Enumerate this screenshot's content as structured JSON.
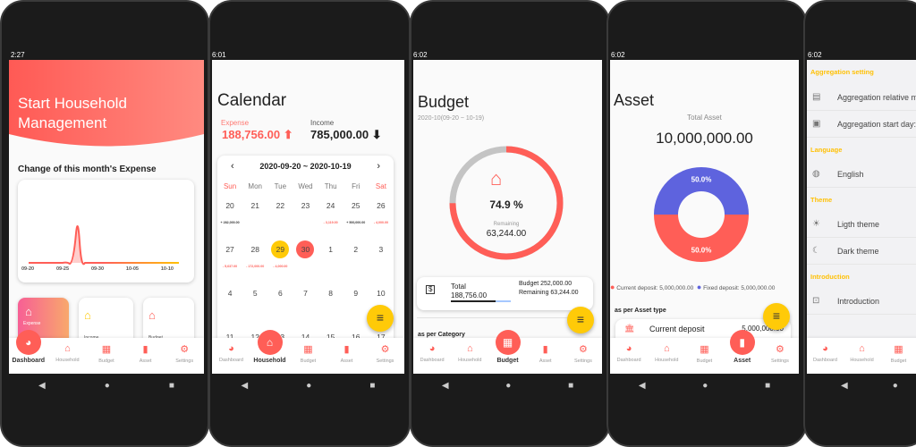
{
  "colors": {
    "accent": "#ff5e57",
    "fab": "#ffca08",
    "fixed": "#5e63de",
    "settings_header": "#ffc107"
  },
  "bottom_nav": [
    "Dashboard",
    "Household",
    "Budget",
    "Asset",
    "Settings"
  ],
  "phones": {
    "dashboard": {
      "time": "2:27",
      "title_line1": "Start Household",
      "title_line2": "Management",
      "chart_title": "Change of this month's Expense",
      "chart_data": {
        "type": "area",
        "x_ticks": [
          "09-20",
          "09-25",
          "09-30",
          "10-05",
          "10-10"
        ],
        "description_values": [
          0,
          0,
          0.01,
          0,
          0.02,
          1,
          0,
          0,
          0,
          0,
          0,
          0,
          0,
          0,
          0,
          0,
          0,
          0,
          0,
          0,
          0,
          0,
          0,
          0,
          0
        ]
      },
      "cards": [
        "Expense",
        "Income",
        "Budget"
      ]
    },
    "calendar": {
      "time": "6:01",
      "title": "Calendar",
      "expense_label": "Expense",
      "expense": "188,756.00",
      "income_label": "Income",
      "income": "785,000.00",
      "range": "2020-09-20 ~ 2020-10-19",
      "weekdays": [
        "Sun",
        "Mon",
        "Tue",
        "Wed",
        "Thu",
        "Fri",
        "Sat"
      ],
      "weeks": [
        {
          "days": [
            "20",
            "21",
            "22",
            "23",
            "24",
            "25",
            "26"
          ],
          "amounts": [
            "+ 282,000.00",
            "",
            "",
            "",
            "- 3,119.00",
            "+ 500,000.00",
            "- 4,000.00"
          ]
        },
        {
          "days": [
            "27",
            "28",
            "29",
            "30",
            "1",
            "2",
            "3"
          ],
          "amounts": [
            "- 5,637.00",
            "- 172,000.00",
            "- 4,000.00",
            "",
            "",
            "",
            ""
          ]
        },
        {
          "days": [
            "4",
            "5",
            "6",
            "7",
            "8",
            "9",
            "10"
          ],
          "amounts": [
            "",
            "",
            "",
            "",
            "",
            "",
            ""
          ]
        },
        {
          "days": [
            "11",
            "12",
            "13",
            "14",
            "15",
            "16",
            "17"
          ],
          "amounts": [
            "",
            "",
            "",
            "",
            "",
            "",
            ""
          ]
        }
      ]
    },
    "budget": {
      "time": "6:02",
      "title": "Budget",
      "period": "2020-10(09-20 ~ 10-19)",
      "percent": "74.9 %",
      "percent_value": 74.9,
      "remaining_label": "Remaining",
      "remaining": "63,244.00",
      "total_label": "Total",
      "total": "188,756.00",
      "budget_line": "Budget 252,000.00",
      "remaining_line": "Remaining 63,244.00",
      "section": "as per Category"
    },
    "asset": {
      "time": "6:02",
      "title": "Asset",
      "total_label": "Total Asset",
      "total": "10,000,000.00",
      "chart_data": {
        "type": "pie",
        "slices": [
          {
            "name": "Fixed deposit",
            "value": 5000000,
            "label": "50.0%",
            "color": "#5e63de"
          },
          {
            "name": "Current deposit",
            "value": 5000000,
            "label": "50.0%",
            "color": "#ff5e57"
          }
        ]
      },
      "legend_current": "Current deposit: 5,000,000.00",
      "legend_fixed": "Fixed deposit: 5,000,000.00",
      "section": "as per Asset type",
      "row_name": "Current deposit",
      "row_value": "5,000,000.00"
    },
    "settings": {
      "time": "6:02",
      "h1": "Aggregation setting",
      "r1": "Aggregation relative m",
      "r2": "Aggregation start day:",
      "h2": "Language",
      "r3": "English",
      "h3": "Theme",
      "r4": "Ligth theme",
      "r5": "Dark theme",
      "h4": "Introduction",
      "r6": "Introduction"
    }
  }
}
